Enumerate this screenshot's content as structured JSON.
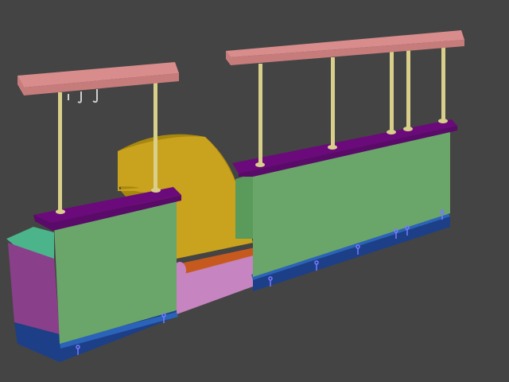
{
  "scene": {
    "background": "#444444",
    "palette": {
      "shelf_top": "#d98c8c",
      "shelf_front": "#c77c7c",
      "counter_front": "#6aa56a",
      "counter_top": "#6b0a7a",
      "counter_top_front": "#5a0a68",
      "side_panel": "#8a3f8a",
      "base": "#1c3f88",
      "base_top": "#2a63b8",
      "pole": "#d9cf8a",
      "pole_shadow": "#9f9862",
      "canopy": "#c9a21e",
      "canopy_dark": "#a8870f",
      "ledge": "#c65a1e",
      "pink_panel": "#c684c0",
      "green_top": "#4bb48a",
      "hook": "#cfcfcf"
    }
  }
}
